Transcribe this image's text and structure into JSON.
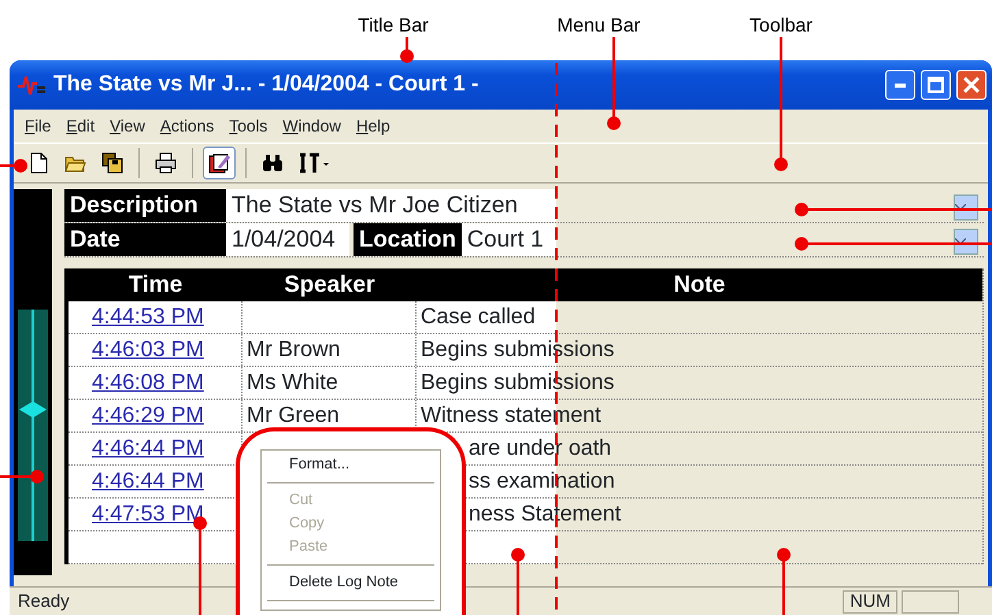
{
  "annotations": [
    {
      "label": "Title Bar"
    },
    {
      "label": "Menu Bar"
    },
    {
      "label": "Toolbar"
    }
  ],
  "window": {
    "title": "The State vs Mr J... - 1/04/2004 - Court 1 -"
  },
  "menu": [
    "File",
    "Edit",
    "View",
    "Actions",
    "Tools",
    "Window",
    "Help"
  ],
  "toolbar": [
    {
      "pressed": false
    },
    {
      "pressed": false
    },
    {
      "pressed": false
    },
    {
      "pressed": false
    },
    {
      "pressed": true
    },
    {
      "pressed": false
    },
    {
      "pressed": false
    }
  ],
  "case": {
    "description_label": "Description",
    "description": "The State vs Mr Joe Citizen",
    "date_label": "Date",
    "date": "1/04/2004",
    "location_label": "Location",
    "location": "Court 1"
  },
  "slider": {
    "level": 0.57
  },
  "log": {
    "columns": [
      "Time",
      "Speaker",
      "Note"
    ],
    "rows": [
      {
        "time": "4:44:53 PM",
        "note": "Case called"
      },
      {
        "time": "4:46:03 PM",
        "speaker": "Mr Brown",
        "note": "Begins submissions"
      },
      {
        "time": "4:46:08 PM",
        "speaker": "Ms White",
        "note": "Begins submissions"
      },
      {
        "time": "4:46:29 PM",
        "speaker": "Mr Green",
        "note": "Witness statement"
      },
      {
        "time": "4:46:44 PM",
        "note": "are under oath"
      },
      {
        "time": "4:46:44 PM",
        "note": "ss examination"
      },
      {
        "time": "4:47:53 PM",
        "note": "ness Statement"
      }
    ]
  },
  "context_menu": {
    "items": [
      {
        "kind": "item",
        "label": "Format...",
        "disabled": false
      },
      {
        "kind": "separator"
      },
      {
        "kind": "item",
        "label": "Cut",
        "disabled": true
      },
      {
        "kind": "item",
        "label": "Copy",
        "disabled": true
      },
      {
        "kind": "item",
        "label": "Paste",
        "disabled": true
      },
      {
        "kind": "separator"
      },
      {
        "kind": "item",
        "label": "Delete Log Note",
        "disabled": false
      },
      {
        "kind": "separator"
      }
    ]
  },
  "status_bar": {
    "text": "Ready",
    "indicators": [
      "NUM"
    ]
  }
}
